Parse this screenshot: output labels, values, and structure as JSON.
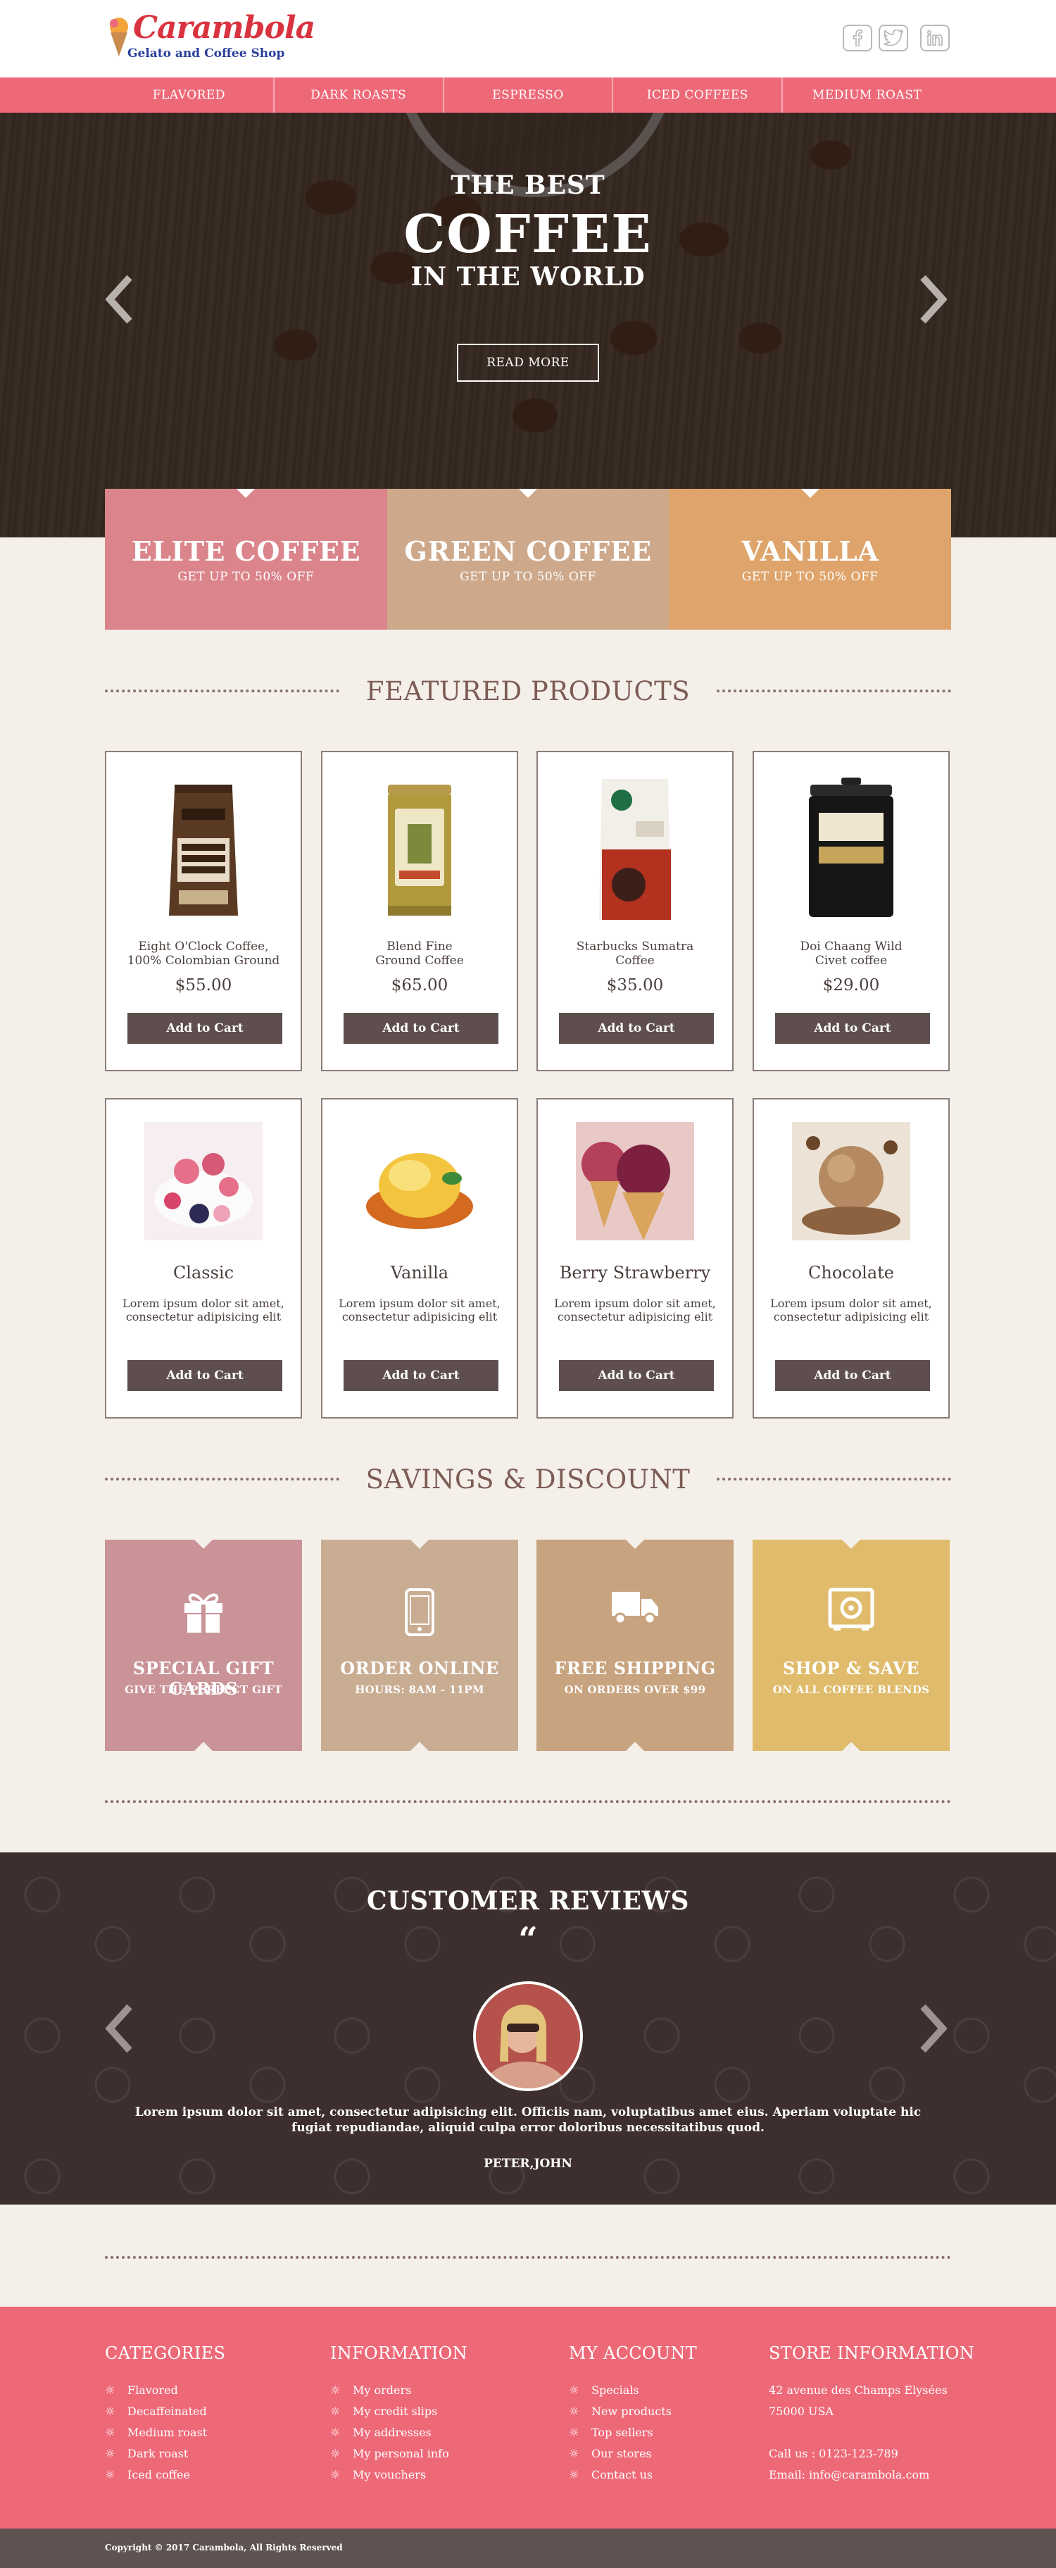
{
  "brand": {
    "name": "Carambola",
    "tagline": "Gelato and Coffee Shop"
  },
  "social": [
    {
      "icon": "facebook-icon"
    },
    {
      "icon": "twitter-icon"
    },
    {
      "icon": "linkedin-icon"
    }
  ],
  "nav": [
    "FLAVORED",
    "DARK ROASTS",
    "ESPRESSO",
    "ICED COFFEES",
    "MEDIUM ROAST"
  ],
  "hero": {
    "line1": "THE BEST",
    "line2": "COFFEE",
    "line3": "IN THE WORLD",
    "button": "READ MORE"
  },
  "promos": [
    {
      "title": "ELITE COFFEE",
      "subtitle": "GET UP TO 50% OFF",
      "color": "#db848b"
    },
    {
      "title": "GREEN COFFEE",
      "subtitle": "GET UP TO 50% OFF",
      "color": "#cda88a"
    },
    {
      "title": "VANILLA",
      "subtitle": "GET UP TO 50% OFF",
      "color": "#dea46b"
    }
  ],
  "featured": {
    "heading": "FEATURED PRODUCTS",
    "coffee": [
      {
        "name1": "Eight O'Clock Coffee,",
        "name2": "100% Colombian Ground",
        "price": "$55.00",
        "button": "Add to Cart"
      },
      {
        "name1": "Blend Fine",
        "name2": "Ground Coffee",
        "price": "$65.00",
        "button": "Add to Cart"
      },
      {
        "name1": "Starbucks Sumatra",
        "name2": "Coffee",
        "price": "$35.00",
        "button": "Add to Cart"
      },
      {
        "name1": "Doi Chaang Wild",
        "name2": "Civet coffee",
        "price": "$29.00",
        "button": "Add to Cart"
      }
    ],
    "gelato": [
      {
        "title": "Classic",
        "desc1": "Lorem ipsum dolor sit amet,",
        "desc2": "consectetur adipisicing elit",
        "button": "Add to Cart"
      },
      {
        "title": "Vanilla",
        "desc1": "Lorem ipsum dolor sit amet,",
        "desc2": "consectetur adipisicing elit",
        "button": "Add to Cart"
      },
      {
        "title": "Berry Strawberry",
        "desc1": "Lorem ipsum dolor sit amet,",
        "desc2": "consectetur adipisicing elit",
        "button": "Add to Cart"
      },
      {
        "title": "Chocolate",
        "desc1": "Lorem ipsum dolor sit amet,",
        "desc2": "consectetur adipisicing elit",
        "button": "Add to Cart"
      }
    ]
  },
  "savings": {
    "heading": "SAVINGS & DISCOUNT",
    "items": [
      {
        "title": "SPECIAL GIFT CARDS",
        "subtitle": "GIVE THE PERFECT GIFT",
        "icon": "gift-icon",
        "color": "#c99398"
      },
      {
        "title": "ORDER  ONLINE",
        "subtitle": "HOURS: 8AM - 11PM",
        "icon": "phone-icon",
        "color": "#c9ad93"
      },
      {
        "title": "FREE  SHIPPING",
        "subtitle": "ON ORDERS OVER $99",
        "icon": "truck-icon",
        "color": "#c8a37f"
      },
      {
        "title": "SHOP & SAVE",
        "subtitle": "ON ALL COFFEE BLENDS",
        "icon": "safe-icon",
        "color": "#dfbb6b"
      }
    ]
  },
  "reviews": {
    "heading": "CUSTOMER REVIEWS",
    "quote_mark": "“",
    "text": "Lorem ipsum dolor sit amet, consectetur adipisicing elit. Officiis nam, voluptatibus amet eius. Aperiam voluptate hic fugiat repudiandae, aliquid culpa error doloribus necessitatibus quod.",
    "author": "PETER,JOHN"
  },
  "footer": {
    "categories": {
      "heading": "CATEGORIES",
      "items": [
        "Flavored",
        "Decaffeinated",
        "Medium roast",
        "Dark roast",
        "Iced coffee"
      ]
    },
    "information": {
      "heading": "INFORMATION",
      "items": [
        "My orders",
        "My credit slips",
        "My addresses",
        "My personal info",
        "My vouchers"
      ]
    },
    "account": {
      "heading": "MY ACCOUNT",
      "items": [
        "Specials",
        "New products",
        "Top sellers",
        "Our stores",
        "Contact us"
      ]
    },
    "store": {
      "heading": "STORE INFORMATION",
      "address1": "42 avenue des Champs Elysées",
      "address2": "75000  USA",
      "phone": "Call us : 0123-123-789",
      "email": "Email: info@carambola.com"
    },
    "copyright": "Copyright © 2017 Carambola, All Rights Reserved"
  },
  "colors": {
    "accent": "#ee6978",
    "dark": "#3d2f2d",
    "button": "#5e4f4e",
    "background": "#f4f0e9"
  }
}
